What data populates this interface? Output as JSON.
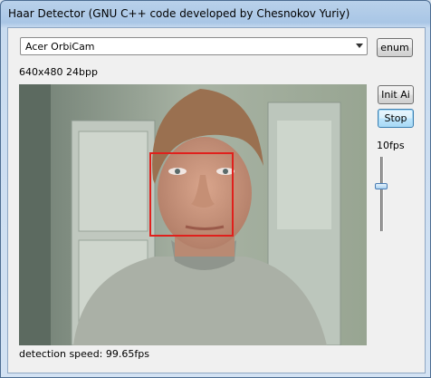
{
  "window": {
    "title": "Haar Detector (GNU C++ code developed by Chesnokov Yuriy)"
  },
  "camera_select": {
    "selected": "Acer OrbiCam"
  },
  "buttons": {
    "enum": "enum",
    "init_ai": "Init Ai",
    "stop": "Stop"
  },
  "video": {
    "format": "640x480 24bpp"
  },
  "frame_rate": {
    "label": "10fps"
  },
  "status": {
    "detection_speed": "detection speed: 99.65fps"
  },
  "colors": {
    "face_box": "#e0201c"
  }
}
